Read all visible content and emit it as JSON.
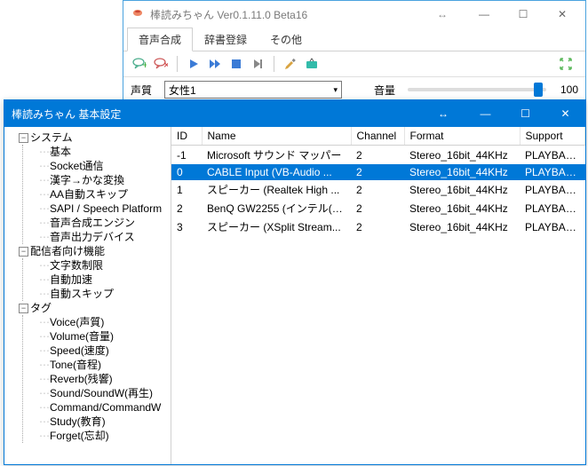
{
  "bgWindow": {
    "title": "棒読みちゃん Ver0.1.11.0 Beta16",
    "midIcon": "↔",
    "minimize": "—",
    "maximize": "☐",
    "close": "✕",
    "tabs": [
      "音声合成",
      "辞書登録",
      "その他"
    ],
    "activeTab": 0,
    "voiceLabel": "声質",
    "voiceValue": "女性1",
    "volumeLabel": "音量",
    "volumeValue": "100"
  },
  "fgWindow": {
    "title": "棒読みちゃん 基本設定",
    "midIcon": "↔",
    "minimize": "—",
    "maximize": "☐",
    "close": "✕"
  },
  "tree": [
    {
      "label": "システム",
      "expanded": true,
      "children": [
        {
          "label": "基本"
        },
        {
          "label": "Socket通信"
        },
        {
          "label": "漢字→かな変換"
        },
        {
          "label": "AA自動スキップ"
        },
        {
          "label": "SAPI / Speech Platform"
        },
        {
          "label": "音声合成エンジン"
        },
        {
          "label": "音声出力デバイス"
        }
      ]
    },
    {
      "label": "配信者向け機能",
      "expanded": true,
      "children": [
        {
          "label": "文字数制限"
        },
        {
          "label": "自動加速"
        },
        {
          "label": "自動スキップ"
        }
      ]
    },
    {
      "label": "タグ",
      "expanded": true,
      "children": [
        {
          "label": "Voice(声質)"
        },
        {
          "label": "Volume(音量)"
        },
        {
          "label": "Speed(速度)"
        },
        {
          "label": "Tone(音程)"
        },
        {
          "label": "Reverb(残響)"
        },
        {
          "label": "Sound/SoundW(再生)"
        },
        {
          "label": "Command/CommandW"
        },
        {
          "label": "Study(教育)"
        },
        {
          "label": "Forget(忘却)"
        }
      ]
    }
  ],
  "table": {
    "headers": {
      "id": "ID",
      "name": "Name",
      "channel": "Channel",
      "format": "Format",
      "support": "Support"
    },
    "rows": [
      {
        "id": "-1",
        "name": "Microsoft サウンド マッパー",
        "channel": "2",
        "format": "Stereo_16bit_44KHz",
        "support": "PLAYBACKRATE",
        "selected": false
      },
      {
        "id": "0",
        "name": "CABLE Input (VB-Audio ...",
        "channel": "2",
        "format": "Stereo_16bit_44KHz",
        "support": "PLAYBACKRATE",
        "selected": true
      },
      {
        "id": "1",
        "name": "スピーカー (Realtek High ...",
        "channel": "2",
        "format": "Stereo_16bit_44KHz",
        "support": "PLAYBACKRATE",
        "selected": false
      },
      {
        "id": "2",
        "name": "BenQ GW2255 (インテル(R...",
        "channel": "2",
        "format": "Stereo_16bit_44KHz",
        "support": "PLAYBACKRATE",
        "selected": false
      },
      {
        "id": "3",
        "name": "スピーカー (XSplit  Stream...",
        "channel": "2",
        "format": "Stereo_16bit_44KHz",
        "support": "PLAYBACKRATE",
        "selected": false
      }
    ]
  }
}
